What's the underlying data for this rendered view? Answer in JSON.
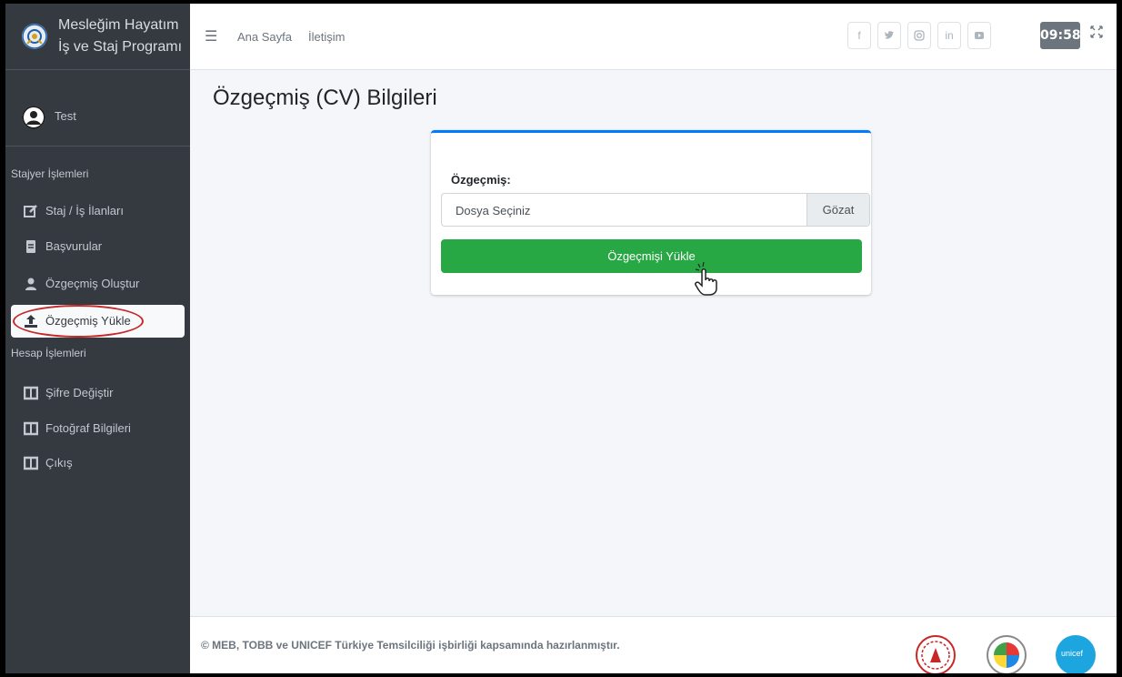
{
  "brand": {
    "line1": "Mesleğim Hayatım",
    "line2": "İş ve Staj Programı"
  },
  "user": {
    "name": "Test"
  },
  "sidebar": {
    "header1": "Stajyer İşlemleri",
    "items": [
      {
        "label": "Staj / İş İlanları",
        "icon": "edit-icon"
      },
      {
        "label": "Başvurular",
        "icon": "document-icon"
      },
      {
        "label": "Özgeçmiş Oluştur",
        "icon": "user-icon"
      },
      {
        "label": "Özgeçmiş Yükle",
        "icon": "upload-icon",
        "active": true
      }
    ],
    "header2": "Hesap İşlemleri",
    "items2": [
      {
        "label": "Şifre Değiştir",
        "icon": "columns-icon"
      },
      {
        "label": "Fotoğraf Bilgileri",
        "icon": "columns-icon"
      },
      {
        "label": "Çıkış",
        "icon": "columns-icon"
      }
    ]
  },
  "topbar": {
    "home": "Ana Sayfa",
    "contact": "İletişim",
    "social_icons": [
      "facebook-icon",
      "twitter-icon",
      "instagram-icon",
      "linkedin-icon",
      "youtube-icon"
    ],
    "clock": "09:58"
  },
  "main": {
    "title": "Özgeçmiş (CV) Bilgileri",
    "field_label": "Özgeçmiş:",
    "file_placeholder": "Dosya Seçiniz",
    "browse_label": "Gözat",
    "upload_label": "Özgeçmişi Yükle"
  },
  "footer": {
    "text": "© MEB, TOBB ve UNICEF Türkiye Temsilciliği işbirliği kapsamında hazırlanmıştır.",
    "unicef_label": "unicef"
  },
  "colors": {
    "sidebar_bg": "#343a40",
    "accent": "#007bff",
    "upload_green": "#28a745",
    "highlight_red": "#c62828"
  }
}
